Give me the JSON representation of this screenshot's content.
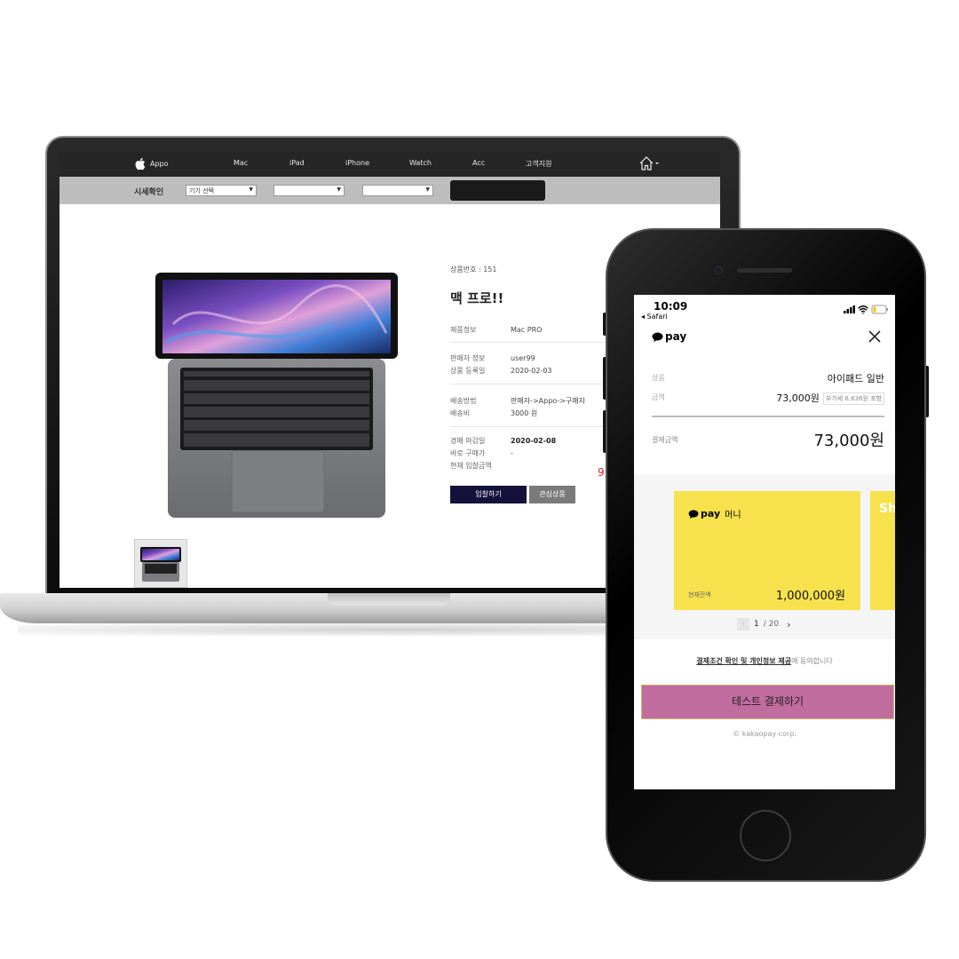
{
  "site": {
    "brand": "Appo",
    "nav": [
      "Mac",
      "iPad",
      "iPhone",
      "Watch",
      "Acc",
      "고객지원"
    ],
    "filter_label": "시세확인",
    "select_device": "기기 선택"
  },
  "product": {
    "number_label": "상품번호 : 151",
    "title": "맥 프로!!",
    "info_k": "제품정보",
    "info_v": "Mac PRO",
    "seller_k": "판매자 정보",
    "seller_v": "user99",
    "date_k": "상품 등록일",
    "date_v": "2020-02-03",
    "ship_k": "배송방법",
    "ship_v": "판매자->Appo->구매자",
    "fee_k": "배송비",
    "fee_v": "3000 원",
    "deadline_k": "경매 마감일",
    "deadline_v": "2020-02-08",
    "buynow_k": "바로 구매가",
    "buynow_v": "-",
    "current_k": "현재 입찰금액",
    "red_partial": "9",
    "bid_button": "입찰하기",
    "wish_button": "관심상품"
  },
  "phone": {
    "time": "10:09",
    "back": "◂ Safari",
    "pay_brand": "pay",
    "item_k": "상품",
    "item_v": "아이패드 일반",
    "amount_k": "금액",
    "amount_v": "73,000원",
    "vat": "부가세 6,636원 포함",
    "total_k": "결제금액",
    "total_v": "73,000원",
    "card_brand": "pay",
    "card_money": "머니",
    "balance_k": "현재잔액",
    "balance_v": "1,000,000원",
    "card2_glyph": "Sh",
    "pager_current": "1",
    "pager_total": "/ 20",
    "agree_link": "결제조건 확인 및 개인정보 제공",
    "agree_rest": "에 동의합니다",
    "pay_button": "테스트 결제하기",
    "copyright": "© kakaopay corp."
  },
  "colors": {
    "kakao_yellow": "#f7e14d",
    "pay_button": "#c16c9e",
    "bid_button": "#12123a"
  }
}
